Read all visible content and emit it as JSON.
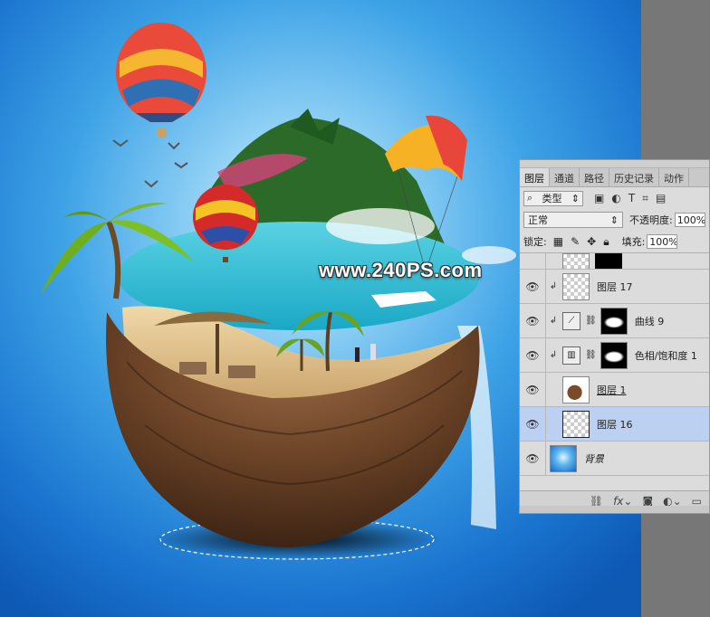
{
  "watermark": "www.240PS.com",
  "panel": {
    "tabs": [
      "图层",
      "通道",
      "路径",
      "历史记录",
      "动作"
    ],
    "filter": {
      "label": "类型",
      "icon": "search-icon"
    },
    "blend_mode": "正常",
    "opacity_label": "不透明度:",
    "opacity_value": "100%",
    "lock_label": "锁定:",
    "fill_label": "填充:",
    "fill_value": "100%",
    "layers": [
      {
        "name": "",
        "partial": true
      },
      {
        "name": "图层 17",
        "clipped": true
      },
      {
        "name": "曲线 9",
        "clipped": true,
        "adjustment": "curves-icon"
      },
      {
        "name": "色相/饱和度 1",
        "clipped": true,
        "adjustment": "hue-saturation-icon"
      },
      {
        "name": "图层 1",
        "smart_object": true
      },
      {
        "name": "图层 16",
        "selected": true
      },
      {
        "name": "背景",
        "background": true
      }
    ],
    "bottom_icons": [
      "link-icon",
      "fx-icon",
      "mask-icon",
      "adjustment-icon",
      "folder-icon"
    ]
  },
  "colors": {
    "selected_row": "#bcd0f2",
    "canvas_center": "#8fd0f5",
    "canvas_edge": "#0d59b4"
  }
}
